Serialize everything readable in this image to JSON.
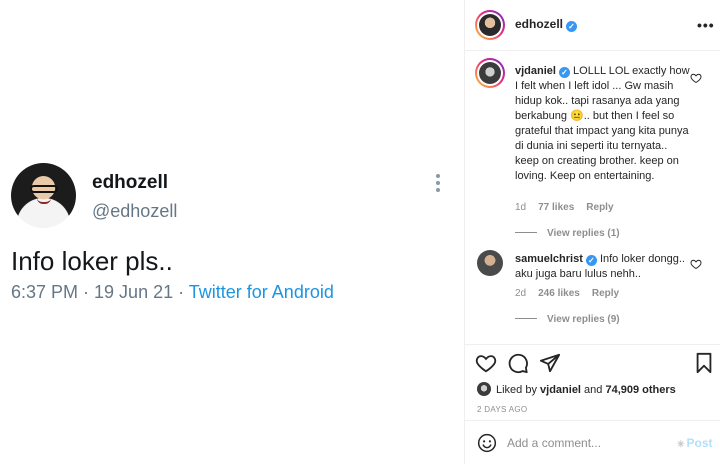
{
  "tweet": {
    "display_name": "edhozell",
    "handle": "@edhozell",
    "text": "Info loker pls..",
    "time_date": "6:37 PM · 19 Jun 21 · ",
    "source": "Twitter for Android"
  },
  "post": {
    "author": "edhozell",
    "author_verified_icon": "verified-badge-icon",
    "more_icon": "•••"
  },
  "comments": [
    {
      "user": "vjdaniel",
      "text": "LOLLL LOL exactly how I felt when I left idol ... Gw masih hidup kok.. tapi rasanya ada yang berkabung 😐.. but then I feel so grateful that impact yang kita punya di dunia ini seperti itu ternyata.. keep on creating brother. keep on loving. Keep on entertaining.",
      "age": "1d",
      "likes": "77 likes",
      "reply_label": "Reply",
      "view_replies": "View replies (1)"
    },
    {
      "user": "samuelchrist",
      "text": "Info loker dongg.. aku juga baru lulus nehh..",
      "age": "2d",
      "likes": "246 likes",
      "reply_label": "Reply",
      "view_replies": "View replies (9)"
    }
  ],
  "actions": {
    "liked_by_prefix": "Liked by ",
    "liked_by_user": "vjdaniel",
    "liked_by_and": " and ",
    "liked_by_others": "74,909 others",
    "timestamp": "2 DAYS AGO"
  },
  "add_comment": {
    "placeholder": "Add a comment...",
    "post_label": "Post"
  },
  "colors": {
    "tweet_link": "#1b95e0",
    "verified": "#3897f0",
    "post_disabled": "#b2dffc"
  }
}
